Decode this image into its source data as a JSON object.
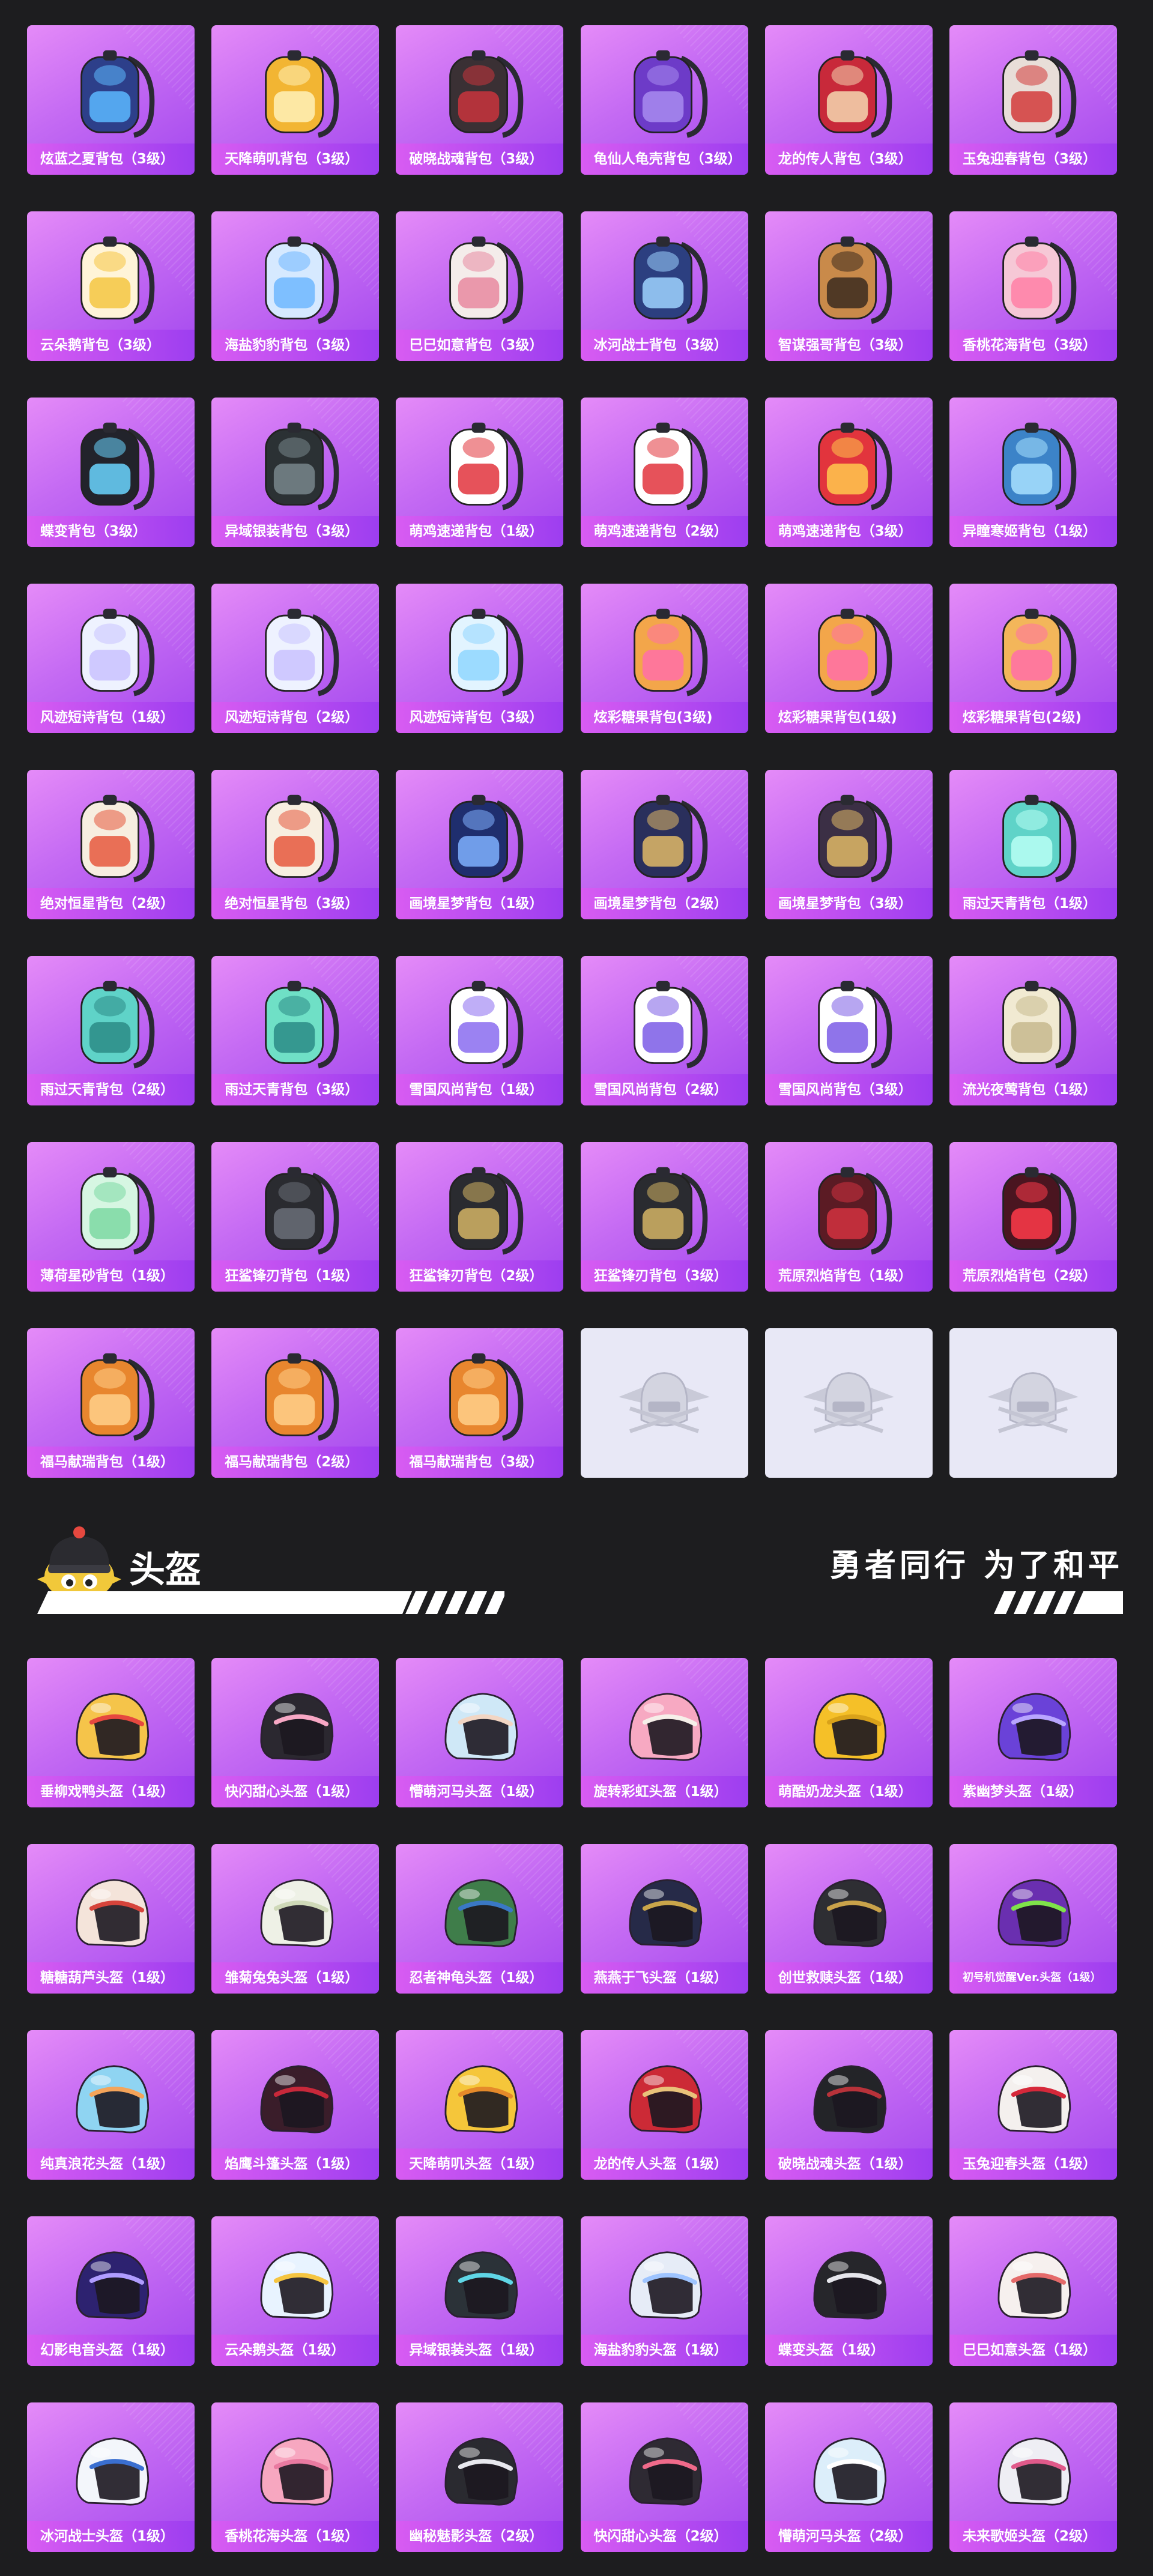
{
  "backpacks": [
    {
      "name": "炫蓝之夏背包（3级）",
      "icon": "backpack-blue-icon",
      "color": "#2d3f8a",
      "accent": "#5cb9ff"
    },
    {
      "name": "天降萌叽背包（3级）",
      "icon": "backpack-yellow-icon",
      "color": "#f2b533",
      "accent": "#fff1b8"
    },
    {
      "name": "破晓战魂背包（3级）",
      "icon": "backpack-armor-icon",
      "color": "#3a3034",
      "accent": "#c9343d"
    },
    {
      "name": "龟仙人龟壳背包（3级）",
      "icon": "turtle-shell-backpack-icon",
      "color": "#6d3bc8",
      "accent": "#a88cf0"
    },
    {
      "name": "龙的传人背包（3级）",
      "icon": "backpack-red-icon",
      "color": "#c8293a",
      "accent": "#f4d7b0"
    },
    {
      "name": "玉兔迎春背包（3级）",
      "icon": "backpack-rabbit-icon",
      "color": "#e8ded8",
      "accent": "#d23b3b"
    },
    {
      "name": "云朵鹅背包（3级）",
      "icon": "cloud-goose-backpack-icon",
      "color": "#fff4d8",
      "accent": "#f5c542"
    },
    {
      "name": "海盐豹豹背包（3级）",
      "icon": "seal-backpack-icon",
      "color": "#d6e9ff",
      "accent": "#6fb7ff"
    },
    {
      "name": "巳巳如意背包（3级）",
      "icon": "snake-backpack-icon",
      "color": "#f4ecea",
      "accent": "#e78aa0"
    },
    {
      "name": "冰河战士背包（3级）",
      "icon": "backpack-ice-icon",
      "color": "#2c3f80",
      "accent": "#9fd4ff"
    },
    {
      "name": "智谋强哥背包（3级）",
      "icon": "bear-backpack-icon",
      "color": "#c98a4a",
      "accent": "#3b2a1e"
    },
    {
      "name": "香桃花海背包（3级）",
      "icon": "flower-backpack-icon",
      "color": "#f6c8d6",
      "accent": "#ff7fa6"
    },
    {
      "name": "蝶变背包（3级）",
      "icon": "butterfly-backpack-icon",
      "color": "#22232b",
      "accent": "#6ad5ff"
    },
    {
      "name": "异域银装背包（3级）",
      "icon": "backpack-tactical-icon",
      "color": "#2b3134",
      "accent": "#78868c"
    },
    {
      "name": "萌鸡速递背包（1级）",
      "icon": "chick-backpack-icon",
      "color": "#ffffff",
      "accent": "#e2343d"
    },
    {
      "name": "萌鸡速递背包（2级）",
      "icon": "chick-backpack-icon",
      "color": "#ffffff",
      "accent": "#e2343d"
    },
    {
      "name": "萌鸡速递背包（3级）",
      "icon": "chick-backpack-icon",
      "color": "#e2343d",
      "accent": "#ffc94d"
    },
    {
      "name": "异瞳寒姬背包（1级）",
      "icon": "backpack-blue-light-icon",
      "color": "#3c83c8",
      "accent": "#a8e2ff"
    },
    {
      "name": "风迹短诗背包（1级）",
      "icon": "poem-pouch-icon",
      "color": "#eef2ff",
      "accent": "#c9c2ff"
    },
    {
      "name": "风迹短诗背包（2级）",
      "icon": "poem-pouch-icon",
      "color": "#eef2ff",
      "accent": "#c9c2ff"
    },
    {
      "name": "风迹短诗背包（3级）",
      "icon": "poem-pouch-icon",
      "color": "#e2f4ff",
      "accent": "#8fd6ff"
    },
    {
      "name": "炫彩糖果背包(3级)",
      "icon": "donut-backpack-icon",
      "color": "#f3a64a",
      "accent": "#ff6fa8"
    },
    {
      "name": "炫彩糖果背包(1级)",
      "icon": "donut-backpack-icon",
      "color": "#f3a64a",
      "accent": "#ff6fa8"
    },
    {
      "name": "炫彩糖果背包(2级)",
      "icon": "donut-backpack-icon",
      "color": "#f3b65a",
      "accent": "#ff6fa8"
    },
    {
      "name": "绝对恒星背包（2级）",
      "icon": "noodle-box-backpack-icon",
      "color": "#f7eee0",
      "accent": "#e6583d"
    },
    {
      "name": "绝对恒星背包（3级）",
      "icon": "noodle-box-backpack-icon",
      "color": "#f7eee0",
      "accent": "#e6583d"
    },
    {
      "name": "画境星梦背包（1级）",
      "icon": "book-backpack-icon",
      "color": "#1f2e6e",
      "accent": "#7fb0ff"
    },
    {
      "name": "画境星梦背包（2级）",
      "icon": "book-backpack-icon",
      "color": "#2a2f5c",
      "accent": "#e0b866"
    },
    {
      "name": "画境星梦背包（3级）",
      "icon": "book-backpack-icon",
      "color": "#3b2f45",
      "accent": "#e0b866"
    },
    {
      "name": "雨过天青背包（1级）",
      "icon": "drop-backpack-icon",
      "color": "#5fd3c8",
      "accent": "#b8fff4"
    },
    {
      "name": "雨过天青背包（2级）",
      "icon": "pouch-teal-icon",
      "color": "#5fd3c8",
      "accent": "#2c8b86"
    },
    {
      "name": "雨过天青背包（3级）",
      "icon": "pouch-teal-icon",
      "color": "#6fe0c6",
      "accent": "#2c8b86"
    },
    {
      "name": "雪国风尚背包（1级）",
      "icon": "penguin-backpack-icon",
      "color": "#ffffff",
      "accent": "#8a6cf0"
    },
    {
      "name": "雪国风尚背包（2级）",
      "icon": "penguin-backpack-icon",
      "color": "#ffffff",
      "accent": "#7b5ce6"
    },
    {
      "name": "雪国风尚背包（3级）",
      "icon": "penguin-backpack-icon",
      "color": "#ffffff",
      "accent": "#7b5ce6"
    },
    {
      "name": "流光夜莺背包（1级）",
      "icon": "pouch-cream-icon",
      "color": "#f1ead2",
      "accent": "#c7b98e"
    },
    {
      "name": "薄荷星砂背包（1级）",
      "icon": "jar-backpack-icon",
      "color": "#d6f6e2",
      "accent": "#7cd8a2"
    },
    {
      "name": "狂鲨锋刃背包（1级）",
      "icon": "shark-backpack-icon",
      "color": "#2a2b30",
      "accent": "#6a6f78"
    },
    {
      "name": "狂鲨锋刃背包（2级）",
      "icon": "shark-backpack-icon",
      "color": "#2a2b30",
      "accent": "#d4b465"
    },
    {
      "name": "狂鲨锋刃背包（3级）",
      "icon": "shark-backpack-icon",
      "color": "#2a2b30",
      "accent": "#d4b465"
    },
    {
      "name": "荒原烈焰背包（1级）",
      "icon": "flame-mask-backpack-icon",
      "color": "#5b1b24",
      "accent": "#d2313f"
    },
    {
      "name": "荒原烈焰背包（2级）",
      "icon": "flame-mask-backpack-icon",
      "color": "#4a1520",
      "accent": "#ff3a4a"
    },
    {
      "name": "福马献瑞背包（1级）",
      "icon": "horse-backpack-icon",
      "color": "#e8862e",
      "accent": "#ffd08a"
    },
    {
      "name": "福马献瑞背包（2级）",
      "icon": "horse-backpack-icon",
      "color": "#e8862e",
      "accent": "#ffd08a"
    },
    {
      "name": "福马献瑞背包（3级）",
      "icon": "horse-backpack-icon",
      "color": "#e8862e",
      "accent": "#ffd08a"
    }
  ],
  "empty_slots": [
    {
      "icon": "pubg-emblem-placeholder-icon"
    },
    {
      "icon": "pubg-emblem-placeholder-icon"
    },
    {
      "icon": "pubg-emblem-placeholder-icon"
    }
  ],
  "section": {
    "title": "头盔",
    "slogan": "勇者同行 为了和平",
    "mascot_icon": "helmet-mascot-icon"
  },
  "helmets": [
    {
      "name": "垂柳戏鸭头盔（1级）",
      "icon": "helmet-icon",
      "color": "#f5c44a",
      "accent": "#e6483f"
    },
    {
      "name": "快闪甜心头盔（1级）",
      "icon": "helmet-icon",
      "color": "#2b2830",
      "accent": "#f7a7c4"
    },
    {
      "name": "懵萌河马头盔（1级）",
      "icon": "helmet-icon",
      "color": "#cfe8f7",
      "accent": "#f2d6c4"
    },
    {
      "name": "旋转彩虹头盔（1级）",
      "icon": "helmet-icon",
      "color": "#f7a9c2",
      "accent": "#f6efe9"
    },
    {
      "name": "萌酷奶龙头盔（1级）",
      "icon": "helmet-icon",
      "color": "#f5c028",
      "accent": "#d9a21a"
    },
    {
      "name": "紫幽梦头盔（1级）",
      "icon": "helmet-icon",
      "color": "#6a42d8",
      "accent": "#b8a5ff"
    },
    {
      "name": "糖糖葫芦头盔（1级）",
      "icon": "helmet-icon",
      "color": "#f4e4da",
      "accent": "#d6443b"
    },
    {
      "name": "雏菊兔兔头盔（1级）",
      "icon": "helmet-icon",
      "color": "#eef1e6",
      "accent": "#cfd9b8"
    },
    {
      "name": "忍者神龟头盔（1级）",
      "icon": "helmet-icon",
      "color": "#3f7d4a",
      "accent": "#3a78c4"
    },
    {
      "name": "燕燕于飞头盔（1级）",
      "icon": "helmet-icon",
      "color": "#262a48",
      "accent": "#c9a54a"
    },
    {
      "name": "创世救赎头盔（1级）",
      "icon": "helmet-icon",
      "color": "#2e2e33",
      "accent": "#c9a24a"
    },
    {
      "name": "初号机觉醒Ver.头盔（1级）",
      "icon": "helmet-icon",
      "color": "#6a2fb0",
      "accent": "#7fe34a"
    },
    {
      "name": "纯真浪花头盔（1级）",
      "icon": "helmet-icon",
      "color": "#8fd4f2",
      "accent": "#f4a45a"
    },
    {
      "name": "焰鹰斗篷头盔（1级）",
      "icon": "helmet-icon",
      "color": "#3a1d2a",
      "accent": "#c8283a"
    },
    {
      "name": "天降萌叽头盔（1级）",
      "icon": "helmet-icon",
      "color": "#f5c63a",
      "accent": "#e58a2a"
    },
    {
      "name": "龙的传人头盔（1级）",
      "icon": "helmet-icon",
      "color": "#cc2a36",
      "accent": "#e9c27a"
    },
    {
      "name": "破晓战魂头盔（1级）",
      "icon": "helmet-icon",
      "color": "#232428",
      "accent": "#b8323a"
    },
    {
      "name": "玉兔迎春头盔（1级）",
      "icon": "helmet-icon",
      "color": "#f4f0ee",
      "accent": "#d6283a"
    },
    {
      "name": "幻影电音头盔（1级）",
      "icon": "helmet-icon",
      "color": "#2d2270",
      "accent": "#b09cff"
    },
    {
      "name": "云朵鹅头盔（1级）",
      "icon": "helmet-icon",
      "color": "#e8f3ff",
      "accent": "#f5c542"
    },
    {
      "name": "异域银装头盔（1级）",
      "icon": "helmet-icon",
      "color": "#2b3238",
      "accent": "#5fd6e6"
    },
    {
      "name": "海盐豹豹头盔（1级）",
      "icon": "helmet-icon",
      "color": "#e6ecf7",
      "accent": "#9ec4ff"
    },
    {
      "name": "蝶变头盔（1级）",
      "icon": "helmet-icon",
      "color": "#26262b",
      "accent": "#e6e6ec"
    },
    {
      "name": "巳巳如意头盔（1级）",
      "icon": "helmet-icon",
      "color": "#f6f0ee",
      "accent": "#e56a6a"
    },
    {
      "name": "冰河战士头盔（1级）",
      "icon": "helmet-icon",
      "color": "#f3f6fb",
      "accent": "#3a6fd0"
    },
    {
      "name": "香桃花海头盔（1级）",
      "icon": "helmet-icon",
      "color": "#f7a7c0",
      "accent": "#e97aa0"
    },
    {
      "name": "幽秘魅影头盔（2级）",
      "icon": "helmet-icon",
      "color": "#2a2a30",
      "accent": "#e8e8ee"
    },
    {
      "name": "快闪甜心头盔（2级）",
      "icon": "helmet-icon",
      "color": "#2e2a33",
      "accent": "#f06a8a"
    },
    {
      "name": "懵萌河马头盔（2级）",
      "icon": "helmet-icon",
      "color": "#dceefa",
      "accent": "#ffffff"
    },
    {
      "name": "未来歌姬头盔（2级）",
      "icon": "helmet-icon",
      "color": "#eeeef4",
      "accent": "#e05a8a"
    }
  ]
}
